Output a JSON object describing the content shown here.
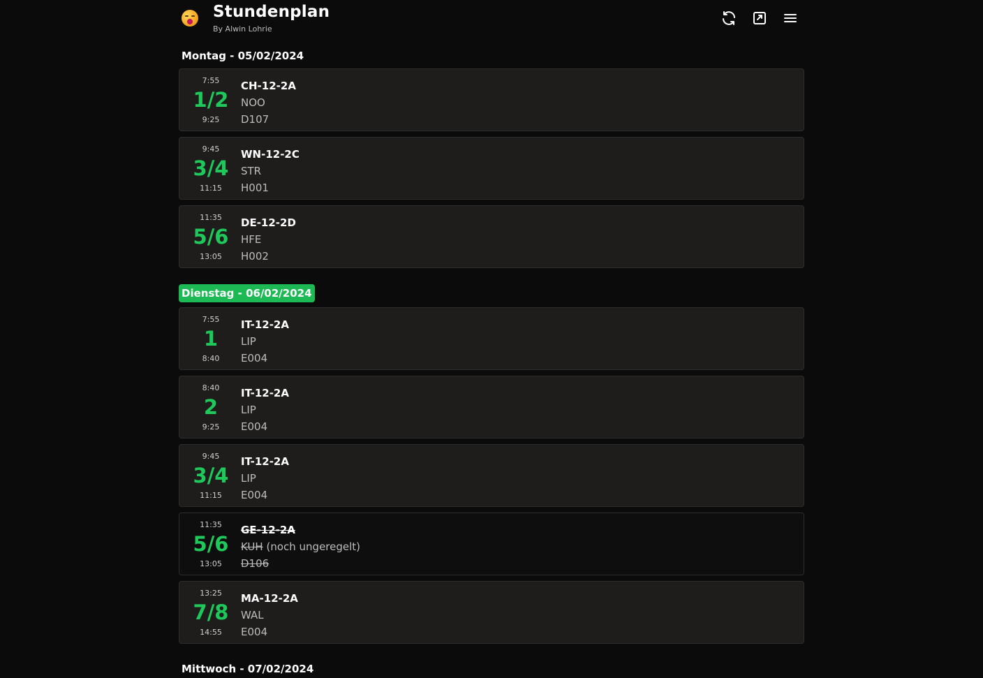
{
  "app": {
    "title": "Stundenplan",
    "subtitle": "By Alwin Lohrie"
  },
  "days": [
    {
      "heading": "Montag - 05/02/2024",
      "today": false,
      "lessons": [
        {
          "start": "7:55",
          "period": "1/2",
          "end": "9:25",
          "class": "CH-12-2A",
          "teacher": "NOO",
          "room": "D107",
          "cancelled": false,
          "note": ""
        },
        {
          "start": "9:45",
          "period": "3/4",
          "end": "11:15",
          "class": "WN-12-2C",
          "teacher": "STR",
          "room": "H001",
          "cancelled": false,
          "note": ""
        },
        {
          "start": "11:35",
          "period": "5/6",
          "end": "13:05",
          "class": "DE-12-2D",
          "teacher": "HFE",
          "room": "H002",
          "cancelled": false,
          "note": ""
        }
      ]
    },
    {
      "heading": "Dienstag - 06/02/2024",
      "today": true,
      "lessons": [
        {
          "start": "7:55",
          "period": "1",
          "end": "8:40",
          "class": "IT-12-2A",
          "teacher": "LIP",
          "room": "E004",
          "cancelled": false,
          "note": ""
        },
        {
          "start": "8:40",
          "period": "2",
          "end": "9:25",
          "class": "IT-12-2A",
          "teacher": "LIP",
          "room": "E004",
          "cancelled": false,
          "note": ""
        },
        {
          "start": "9:45",
          "period": "3/4",
          "end": "11:15",
          "class": "IT-12-2A",
          "teacher": "LIP",
          "room": "E004",
          "cancelled": false,
          "note": ""
        },
        {
          "start": "11:35",
          "period": "5/6",
          "end": "13:05",
          "class": "GE-12-2A",
          "teacher": "KUH",
          "room": "D106",
          "cancelled": true,
          "note": "(noch ungeregelt)"
        },
        {
          "start": "13:25",
          "period": "7/8",
          "end": "14:55",
          "class": "MA-12-2A",
          "teacher": "WAL",
          "room": "E004",
          "cancelled": false,
          "note": ""
        }
      ]
    },
    {
      "heading": "Mittwoch - 07/02/2024",
      "today": false,
      "lessons": []
    }
  ],
  "icons": {
    "refresh": "refresh-icon",
    "open": "open-external-icon",
    "menu": "menu-icon"
  },
  "colors": {
    "accent": "#1ec85a",
    "today_badge": "#1db954",
    "card_bg": "#1f1d1c",
    "page_bg": "#0b0b0b"
  }
}
